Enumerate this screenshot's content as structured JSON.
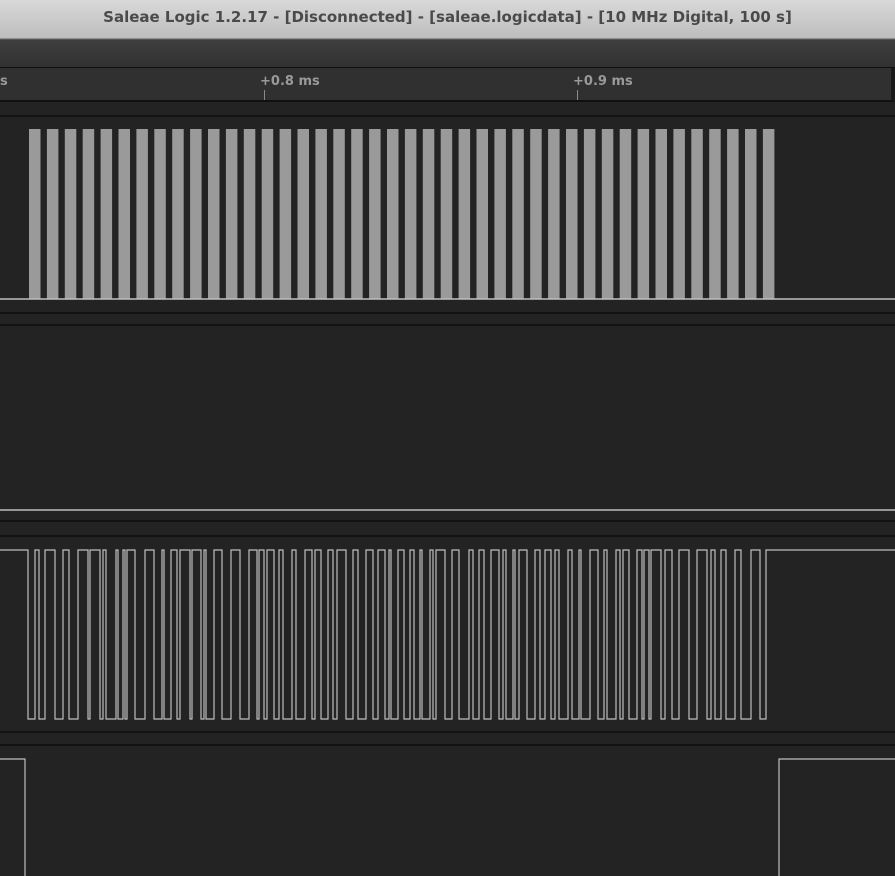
{
  "window": {
    "title": "Saleae Logic 1.2.17 - [Disconnected] - [saleae.logicdata] - [10 MHz Digital, 100 s]"
  },
  "timeline": {
    "labels": [
      "s",
      "+0.8 ms",
      "+0.9 ms"
    ]
  },
  "channels": [
    {
      "signal": "clock-burst"
    },
    {
      "signal": "idle-low"
    },
    {
      "signal": "serial-data"
    },
    {
      "signal": "enable-low"
    }
  ],
  "colors": {
    "background": "#232323",
    "waveform": "#bfbfbf",
    "clock_fill": "#9a9a9a"
  }
}
